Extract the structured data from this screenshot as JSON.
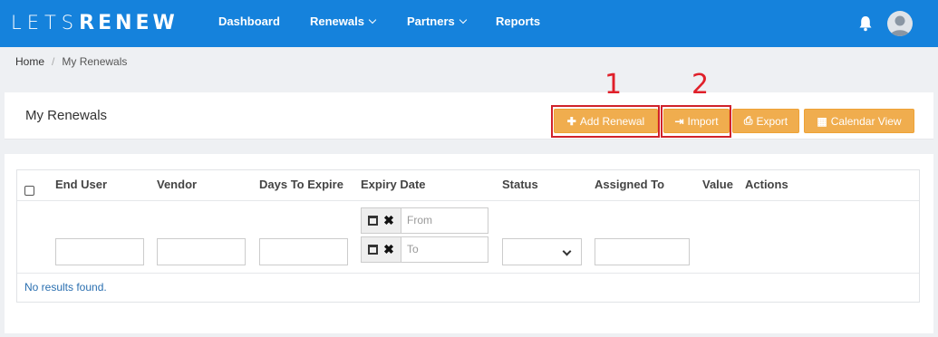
{
  "brand": {
    "lets": "LETS",
    "renew": "RENEW"
  },
  "nav": {
    "dashboard": "Dashboard",
    "renewals": "Renewals",
    "partners": "Partners",
    "reports": "Reports"
  },
  "breadcrumb": {
    "home": "Home",
    "separator": "/",
    "current": "My Renewals"
  },
  "page": {
    "title": "My Renewals"
  },
  "toolbar": {
    "add_renewal": "Add Renewal",
    "import": "Import",
    "export": "Export",
    "calendar_view": "Calendar View"
  },
  "callouts": {
    "one": "1",
    "two": "2"
  },
  "table": {
    "headers": {
      "end_user": "End User",
      "vendor": "Vendor",
      "days_to_expire": "Days To Expire",
      "expiry_date": "Expiry Date",
      "status": "Status",
      "assigned_to": "Assigned To",
      "value": "Value",
      "actions": "Actions"
    },
    "filters": {
      "from_placeholder": "From",
      "to_placeholder": "To"
    },
    "empty_message": "No results found."
  },
  "colors": {
    "navbar": "#1582dc",
    "button": "#f0ad4e",
    "callout": "#d0222a"
  }
}
